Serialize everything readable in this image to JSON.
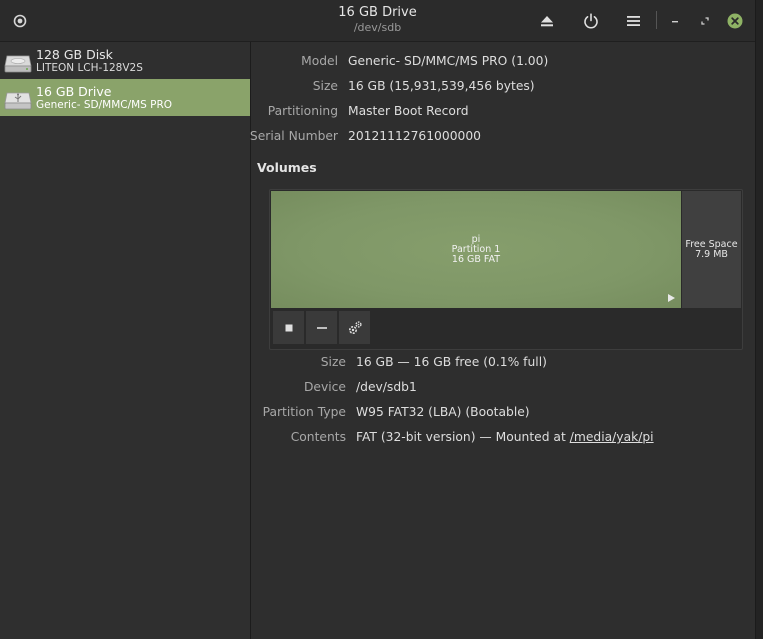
{
  "window": {
    "title": "16 GB Drive",
    "subtitle": "/dev/sdb"
  },
  "headerbar": {
    "icons": [
      "app-menu-icon",
      "eject-icon",
      "power-icon",
      "hamburger-menu-icon",
      "minimize-icon",
      "restore-icon",
      "close-icon"
    ]
  },
  "sidebar": {
    "disks": [
      {
        "name": "128 GB Disk",
        "model": "LITEON LCH-128V2S",
        "selected": false
      },
      {
        "name": "16 GB Drive",
        "model": "Generic- SD/MMC/MS PRO",
        "selected": true
      }
    ]
  },
  "drive": {
    "model_label": "Model",
    "model": "Generic- SD/MMC/MS PRO (1.00)",
    "size_label": "Size",
    "size": "16 GB (15,931,539,456 bytes)",
    "partitioning_label": "Partitioning",
    "partitioning": "Master Boot Record",
    "serial_label": "Serial Number",
    "serial": "20121112761000000"
  },
  "volumes": {
    "title": "Volumes",
    "partition": {
      "name": "pi",
      "number": "Partition 1",
      "desc": "16 GB FAT"
    },
    "free": {
      "label": "Free Space",
      "size": "7.9 MB"
    },
    "toolbar": [
      "stop-icon",
      "minus-icon",
      "gears-icon"
    ]
  },
  "details": {
    "size_label": "Size",
    "size": "16 GB — 16 GB free (0.1% full)",
    "device_label": "Device",
    "device": "/dev/sdb1",
    "ptype_label": "Partition Type",
    "ptype": "W95 FAT32 (LBA) (Bootable)",
    "contents_label": "Contents",
    "contents_prefix": "FAT (32-bit version) — Mounted at ",
    "contents_link": "/media/yak/pi"
  },
  "colors": {
    "selection": "#8aa36a",
    "partition": "#7f9767",
    "background": "#2e2e2e"
  }
}
